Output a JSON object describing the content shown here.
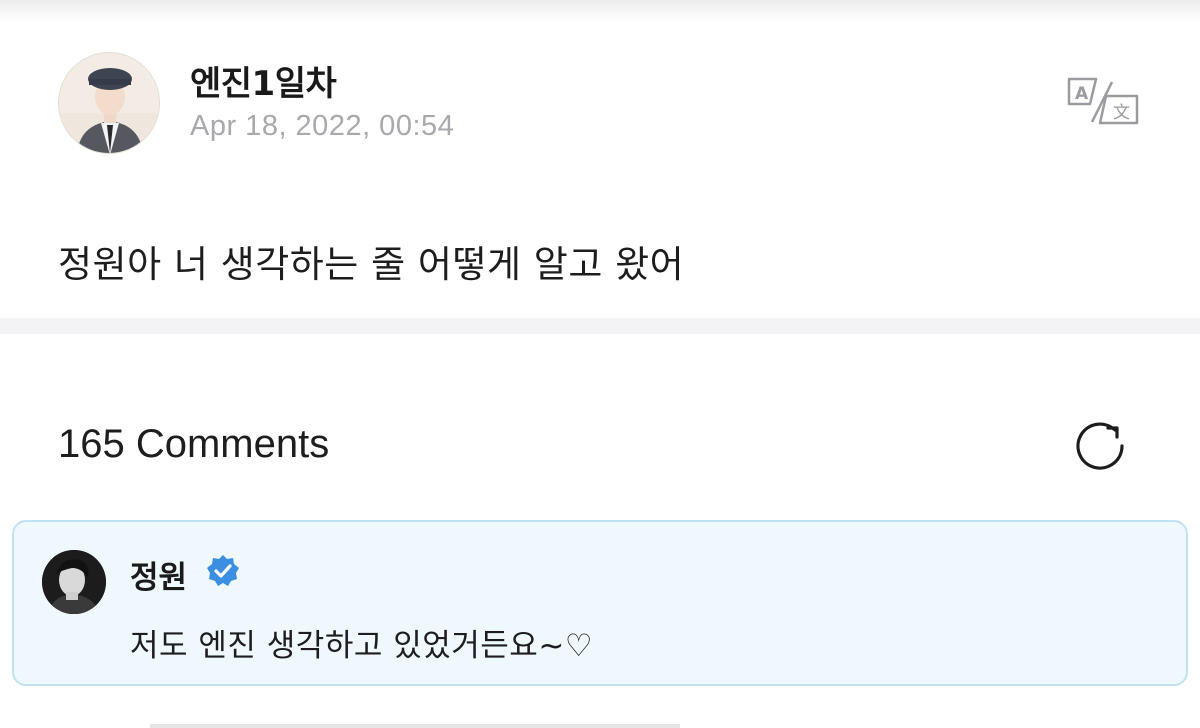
{
  "post": {
    "author": "엔진1일차",
    "date": "Apr 18, 2022, 00:54",
    "body": "정원아 너 생각하는 줄 어떻게 알고 왔어",
    "avatar_icon": "user-avatar-beret",
    "translate_icon": "translate-icon"
  },
  "comments": {
    "title": "165 Comments",
    "refresh_icon": "refresh-icon",
    "items": [
      {
        "author": "정원",
        "verified": true,
        "text": "저도 엔진 생각하고 있었거든요~♡"
      }
    ]
  },
  "colors": {
    "date_gray": "#a8a8ad",
    "comment_bg": "#eff8fd",
    "comment_border": "#bfe2f3",
    "verified_blue": "#3b8fe0"
  }
}
